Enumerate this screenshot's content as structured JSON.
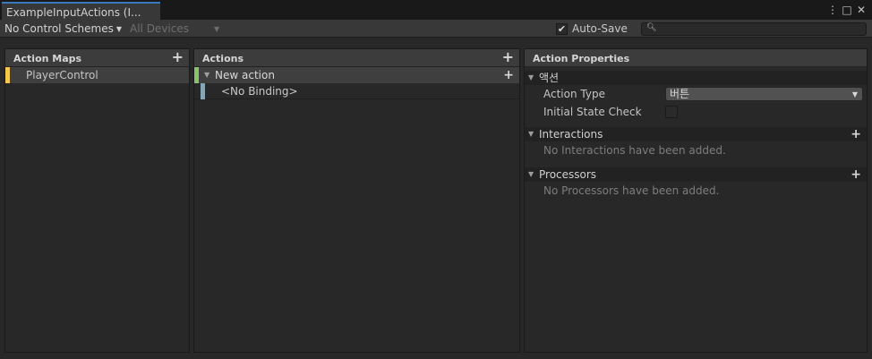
{
  "window": {
    "tab_title": "ExampleInputActions (I...",
    "menu_icon": "⋮",
    "maximize_icon": "□",
    "close_icon": "✕"
  },
  "toolbar": {
    "control_schemes": "No Control Schemes",
    "devices": "All Devices",
    "auto_save_label": "Auto-Save",
    "auto_save_checked": true,
    "search_value": ""
  },
  "action_maps": {
    "header": "Action Maps",
    "items": [
      {
        "label": "PlayerControl",
        "color": "#f3c84d"
      }
    ]
  },
  "actions": {
    "header": "Actions",
    "items": [
      {
        "label": "New action",
        "color": "#88c36c"
      },
      {
        "label": "<No Binding>",
        "color": "#87a6b5"
      }
    ]
  },
  "properties": {
    "header": "Action Properties",
    "section_action": "액션",
    "action_type_label": "Action Type",
    "action_type_value": "버튼",
    "initial_state_label": "Initial State Check",
    "interactions_header": "Interactions",
    "interactions_empty": "No Interactions have been added.",
    "processors_header": "Processors",
    "processors_empty": "No Processors have been added."
  },
  "colors": {
    "accent": "#3a79bb",
    "action_map_bar": "#f3c84d",
    "action_bar": "#88c36c",
    "binding_bar": "#87a6b5"
  }
}
